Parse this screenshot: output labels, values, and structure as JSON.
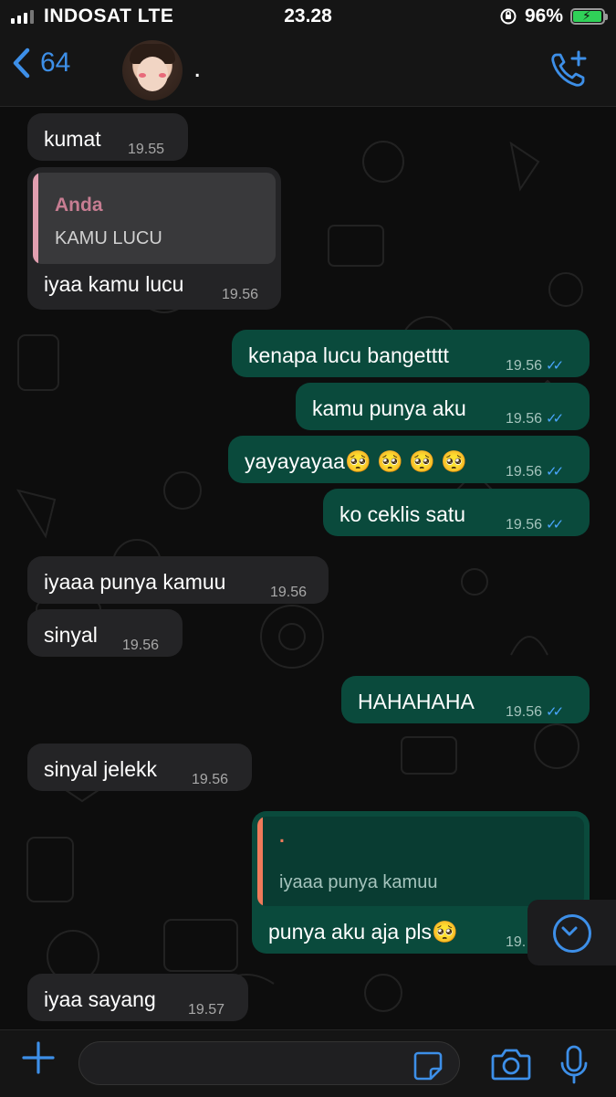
{
  "status_bar": {
    "carrier": "INDOSAT  LTE",
    "time": "23.28",
    "battery": "96%",
    "battery_level": 0.96
  },
  "header": {
    "back_count": "64",
    "contact_name": "."
  },
  "messages": [
    {
      "dir": "in",
      "text": "kumat",
      "time": "19.55"
    },
    {
      "dir": "in",
      "quote_name": "Anda",
      "quote_text": "KAMU LUCU",
      "text": "iyaa kamu lucu",
      "time": "19.56"
    },
    {
      "dir": "out",
      "text": "kenapa lucu bangetttt",
      "time": "19.56"
    },
    {
      "dir": "out",
      "text": "kamu punya aku",
      "time": "19.56"
    },
    {
      "dir": "out",
      "text": "yayayayaa🥺 🥺 🥺 🥺",
      "time": "19.56"
    },
    {
      "dir": "out",
      "text": "ko ceklis satu",
      "time": "19.56"
    },
    {
      "dir": "in",
      "text": "iyaaa punya kamuu",
      "time": "19.56"
    },
    {
      "dir": "in",
      "text": "sinyal",
      "time": "19.56"
    },
    {
      "dir": "out",
      "text": "HAHAHAHA",
      "time": "19.56"
    },
    {
      "dir": "in",
      "text": "sinyal jelekk",
      "time": "19.56"
    },
    {
      "dir": "out",
      "quote_name": ".",
      "quote_text": "iyaaa punya kamuu",
      "text": "punya aku aja pls🥺",
      "time": "19."
    },
    {
      "dir": "in",
      "text": "iyaa sayang",
      "time": "19.57"
    }
  ],
  "colors": {
    "accent": "#3d8fe8",
    "incoming_bubble": "#242426",
    "outgoing_bubble": "#0a4a3c",
    "read_tick": "#4aa6ff",
    "quote_bar_in": "#e29fb0",
    "quote_bar_out": "#f07a5a"
  },
  "icons": {
    "back": "chevron-left-icon",
    "call": "add-call-icon",
    "scroll": "scroll-down-icon",
    "attach": "plus-icon",
    "sticker": "sticker-icon",
    "camera": "camera-icon",
    "mic": "microphone-icon"
  }
}
